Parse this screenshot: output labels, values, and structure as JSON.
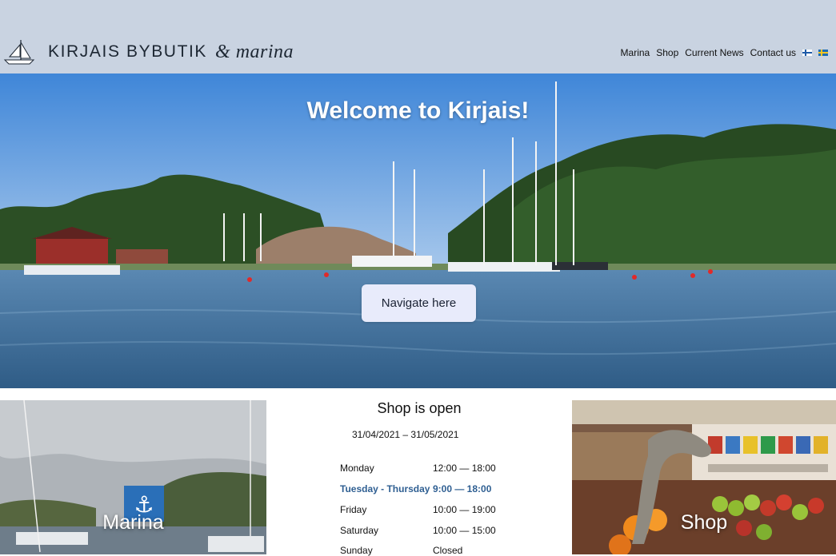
{
  "header": {
    "logo": {
      "name": "KIRJAIS BYBUTIK",
      "suffix": "& marina"
    },
    "nav": [
      {
        "label": "Marina"
      },
      {
        "label": "Shop"
      },
      {
        "label": "Current News"
      },
      {
        "label": "Contact us"
      }
    ],
    "languages": [
      "finnish-flag-icon",
      "swedish-flag-icon"
    ]
  },
  "hero": {
    "title": "Welcome to Kirjais!",
    "button_label": "Navigate here"
  },
  "tiles": {
    "marina_label": "Marina",
    "shop_label": "Shop"
  },
  "hours": {
    "title": "Shop is open",
    "period": "31/04/2021 – 31/05/2021",
    "rows": [
      {
        "day": "Monday",
        "time": "12:00 — 18:00"
      },
      {
        "day": "Tuesday - Thursday",
        "time": "9:00 — 18:00"
      },
      {
        "day": "Friday",
        "time": "10:00 — 19:00"
      },
      {
        "day": "Saturday",
        "time": "10:00 — 15:00"
      },
      {
        "day": "Sunday",
        "time": "Closed"
      }
    ]
  },
  "colors": {
    "header_bg": "#c9d3e1",
    "highlight_text": "#2f5f92",
    "button_bg": "#e8ebfb"
  }
}
